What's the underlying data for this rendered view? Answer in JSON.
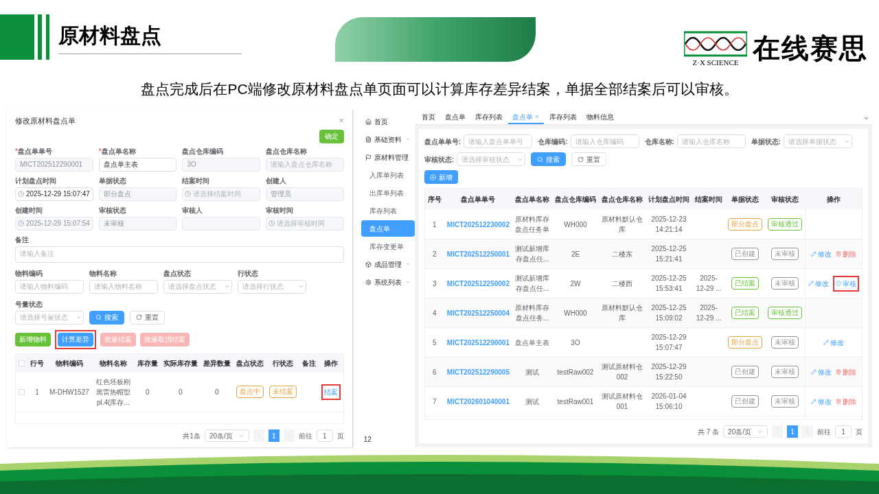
{
  "slide": {
    "title": "原材料盘点",
    "subtitle": "盘点完成后在PC端修改原材料盘点单页面可以计算库存差异结案，单据全部结案后可以审核。",
    "logo_en": "Z·X SCIENCE",
    "logo_cn": "在线赛思"
  },
  "edit_dialog": {
    "title": "修改原材料盘点单",
    "close": "×",
    "confirm": "确定",
    "fields": [
      {
        "label": "盘点单单号",
        "mark": "*",
        "value": "MICT202512290001",
        "disabled": true,
        "kind": "input"
      },
      {
        "label": "盘点单名称",
        "mark": "*",
        "value": "盘点单主表",
        "disabled": false,
        "kind": "input"
      },
      {
        "label": "盘点仓库编码",
        "value": "3O",
        "disabled": true,
        "kind": "input"
      },
      {
        "label": "盘点仓库名称",
        "placeholder": "请输入盘点仓库名称",
        "disabled": true,
        "kind": "input"
      },
      {
        "label": "计划盘点时间",
        "value": "2025-12-29 15:07:47",
        "disabled": false,
        "kind": "date"
      },
      {
        "label": "单据状态",
        "value": "部分盘点",
        "disabled": true,
        "kind": "input"
      },
      {
        "label": "结案时间",
        "placeholder": "请选择结案时间",
        "disabled": true,
        "kind": "date"
      },
      {
        "label": "创建人",
        "value": "管理员",
        "disabled": true,
        "kind": "input"
      },
      {
        "label": "创建时间",
        "value": "2025-12-29 15:07:54",
        "disabled": true,
        "kind": "date"
      },
      {
        "label": "审核状态",
        "value": "未审核",
        "disabled": true,
        "kind": "input"
      },
      {
        "label": "审核人",
        "disabled": true,
        "kind": "input"
      },
      {
        "label": "审核时间",
        "placeholder": "请选择审核时间",
        "disabled": true,
        "kind": "date"
      }
    ],
    "remark": {
      "label": "备注",
      "placeholder": "请输入备注"
    },
    "filters": [
      {
        "label": "物料编码",
        "placeholder": "请输入物料编码",
        "kind": "input"
      },
      {
        "label": "物料名称",
        "placeholder": "请输入物料名称",
        "kind": "input"
      },
      {
        "label": "盘点状态",
        "placeholder": "请选择盘点状态",
        "kind": "select"
      },
      {
        "label": "行状态",
        "placeholder": "请选择行状态",
        "kind": "select"
      },
      {
        "label": "号量状态",
        "placeholder": "请选择号量状态",
        "kind": "select"
      }
    ],
    "filter_buttons": [
      {
        "label": "搜索",
        "kind": "search"
      },
      {
        "label": "重置",
        "kind": "reset"
      }
    ],
    "actions": [
      {
        "label": "新增物料",
        "kind": "success",
        "disabled": false,
        "highlighted": false
      },
      {
        "label": "计算差异",
        "kind": "primary",
        "disabled": false,
        "highlighted": true
      },
      {
        "label": "批量结案",
        "kind": "danger",
        "disabled": true,
        "highlighted": false
      },
      {
        "label": "批量取消结案",
        "kind": "danger",
        "disabled": true,
        "highlighted": false
      }
    ],
    "select_all": {
      "checked": false
    },
    "columns": [
      "行号",
      "物料编码",
      "物料名称",
      "库存量",
      "实际库存量",
      "差异数量",
      "盘点状态",
      "行状态",
      "备注",
      "操作"
    ],
    "rows": [
      {
        "checked": false,
        "no": "1",
        "code": "M-DHW1527",
        "name": "红色坯板刚黑雷热帽型pl.4(库存...",
        "stock": "0",
        "actual": "0",
        "diff": "0",
        "count_status": {
          "label": "盘点中",
          "color": "#e6a23c"
        },
        "line_status": {
          "label": "未结案",
          "color": "#e6a23c"
        },
        "action": {
          "label": "结案",
          "highlighted": true
        }
      }
    ],
    "pagination": {
      "total": "共1条",
      "page_size": "20条/页",
      "pages": [
        {
          "label": "1",
          "selected": true
        }
      ],
      "goto_label": "前往",
      "goto_value": "1",
      "goto_suffix": "页"
    }
  },
  "list_page": {
    "sidebar": [
      {
        "label": "首页",
        "kind": "home"
      },
      {
        "label": "基础资料",
        "kind": "doc",
        "expanded": false
      },
      {
        "label": "原材料管理",
        "kind": "flag",
        "expanded": true,
        "children": [
          {
            "label": "入库单列表",
            "selected": false
          },
          {
            "label": "出库单列表",
            "selected": false
          },
          {
            "label": "库存列表",
            "selected": false
          },
          {
            "label": "盘点单",
            "selected": true
          },
          {
            "label": "库存变更单",
            "selected": false
          }
        ]
      },
      {
        "label": "成品管理",
        "kind": "box",
        "expanded": false
      },
      {
        "label": "系统列表",
        "kind": "gear",
        "expanded": false
      }
    ],
    "page_number": "12",
    "tabs": [
      {
        "label": "首页",
        "selected": false,
        "closable": false
      },
      {
        "label": "盘点单",
        "selected": false,
        "closable": false
      },
      {
        "label": "库存列表",
        "selected": false,
        "closable": false
      },
      {
        "label": "盘点单",
        "selected": true,
        "closable": true
      },
      {
        "label": "库存列表",
        "selected": false,
        "closable": false
      },
      {
        "label": "物料信息",
        "selected": false,
        "closable": false
      }
    ],
    "filters": [
      {
        "label": "盘点单单号:",
        "placeholder": "请输入盘点单单号",
        "kind": "input"
      },
      {
        "label": "仓库编码:",
        "placeholder": "请输入仓库编码",
        "kind": "input"
      },
      {
        "label": "仓库名称:",
        "placeholder": "请输入仓库名称",
        "kind": "input"
      },
      {
        "label": "单据状态:",
        "placeholder": "请选择单据状态",
        "kind": "select"
      },
      {
        "label": "审核状态:",
        "placeholder": "请选择审核状态",
        "kind": "select"
      }
    ],
    "filter_buttons": [
      {
        "label": "搜索",
        "kind": "search"
      },
      {
        "label": "重置",
        "kind": "reset"
      }
    ],
    "add_button": "新增",
    "columns": [
      "序号",
      "盘点单单号",
      "盘点单名称",
      "盘点仓库编码",
      "盘点仓库名称",
      "计划盘点时间",
      "结案时间",
      "单据状态",
      "审核状态",
      "操作"
    ],
    "rows": [
      {
        "no": "1",
        "code": "MICT202512230002",
        "name": "原材料库存盘点任务单",
        "wh_code": "WH000",
        "wh_name": "原材料默认仓库",
        "plan_time": "2025-12-23 14:21:14",
        "doc_status": {
          "label": "部分盘点",
          "color": "#e6a23c"
        },
        "audit_status": {
          "label": "审核通过",
          "color": "#67c23a"
        }
      },
      {
        "no": "2",
        "code": "MICT202512250001",
        "name": "测试新增库存盘点任...",
        "wh_code": "2E",
        "wh_name": "二楼东",
        "plan_time": "2025-12-25 15:21:41",
        "doc_status": {
          "label": "已创建",
          "color": "#909399"
        },
        "audit_status": {
          "label": "未审核",
          "color": "#909399"
        },
        "actions": [
          {
            "label": "修改",
            "kind": "edit",
            "highlighted": false
          },
          {
            "label": "删除",
            "kind": "delete",
            "highlighted": false
          }
        ]
      },
      {
        "no": "3",
        "code": "MICT202512250002",
        "name": "测试新增库存盘点任...",
        "wh_code": "2W",
        "wh_name": "二楼西",
        "plan_time": "2025-12-25 15:53:41",
        "close_time": "2025-12-29 ...",
        "doc_status": {
          "label": "已结案",
          "color": "#67c23a"
        },
        "audit_status": {
          "label": "未审核",
          "color": "#909399"
        },
        "actions": [
          {
            "label": "修改",
            "kind": "edit",
            "highlighted": false
          },
          {
            "label": "审核",
            "kind": "audit",
            "highlighted": true
          }
        ]
      },
      {
        "no": "4",
        "code": "MICT202512250004",
        "name": "原材料库存盘点任务...",
        "wh_code": "WH000",
        "wh_name": "原材料默认仓库",
        "plan_time": "2025-12-25 15:09:02",
        "close_time": "2025-12-29 ...",
        "doc_status": {
          "label": "已结案",
          "color": "#67c23a"
        },
        "audit_status": {
          "label": "审核通过",
          "color": "#67c23a"
        }
      },
      {
        "no": "5",
        "code": "MICT202512290001",
        "name": "盘点单主表",
        "wh_code": "3O",
        "plan_time": "2025-12-29 15:07:47",
        "doc_status": {
          "label": "部分盘点",
          "color": "#e6a23c"
        },
        "audit_status": {
          "label": "未审核",
          "color": "#909399"
        },
        "actions": [
          {
            "label": "修改",
            "kind": "edit",
            "highlighted": false
          }
        ]
      },
      {
        "no": "6",
        "code": "MICT202512290005",
        "name": "测试",
        "wh_code": "testRaw002",
        "wh_name": "测试原材料仓002",
        "plan_time": "2025-12-29 15:22:50",
        "doc_status": {
          "label": "已创建",
          "color": "#909399"
        },
        "audit_status": {
          "label": "未审核",
          "color": "#909399"
        },
        "actions": [
          {
            "label": "修改",
            "kind": "edit",
            "highlighted": false
          },
          {
            "label": "删除",
            "kind": "delete",
            "highlighted": false
          }
        ]
      },
      {
        "no": "7",
        "code": "MICT202601040001",
        "name": "测试",
        "wh_code": "testRaw001",
        "wh_name": "测试原材料仓001",
        "plan_time": "2026-01-04 15:06:10",
        "doc_status": {
          "label": "已创建",
          "color": "#909399"
        },
        "audit_status": {
          "label": "未审核",
          "color": "#909399"
        },
        "actions": [
          {
            "label": "修改",
            "kind": "edit",
            "highlighted": false
          },
          {
            "label": "删除",
            "kind": "delete",
            "highlighted": false
          }
        ]
      }
    ],
    "pagination": {
      "total": "共 7 条",
      "page_size": "20条/页",
      "pages": [
        {
          "label": "1",
          "selected": true
        }
      ],
      "goto_label": "前往",
      "goto_value": "1",
      "goto_suffix": "页"
    }
  }
}
